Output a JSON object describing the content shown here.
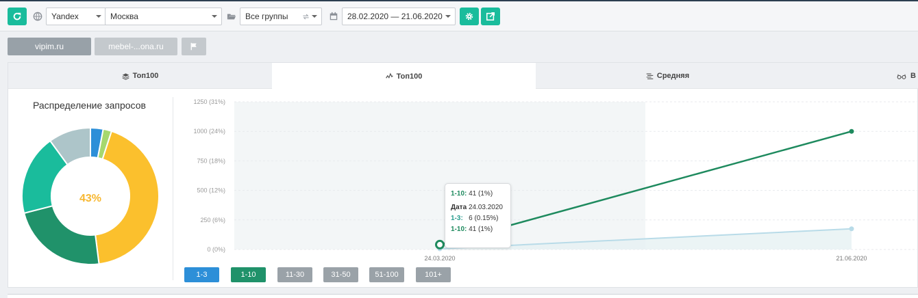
{
  "toolbar": {
    "refresh_icon": "refresh-icon",
    "globe_icon": "globe-icon",
    "search_engine": "Yandex",
    "region": "Москва",
    "folder_icon": "folder-open-icon",
    "group": "Все группы",
    "calendar_icon": "calendar-icon",
    "date_range": "28.02.2020 — 21.06.2020",
    "settings_icon": "gear-icon",
    "export_icon": "external-link-icon"
  },
  "projects": {
    "tabs": [
      "vipim.ru",
      "mebel-...ona.ru"
    ],
    "flag_icon": "flag-icon"
  },
  "panel_tabs": [
    {
      "label": "Топ100",
      "icon": "layers-icon"
    },
    {
      "label": "Топ100",
      "icon": "line-chart-icon"
    },
    {
      "label": "Средняя",
      "icon": "list-icon"
    },
    {
      "label": "В",
      "icon": "glasses-icon"
    }
  ],
  "distribution": {
    "title": "Распределение запросов",
    "center_label": "43%",
    "segments": [
      {
        "name": "1-3",
        "share": 0.03,
        "color": "#2d8fd8"
      },
      {
        "name": "1-10",
        "share": 0.02,
        "color": "#a6d86e"
      },
      {
        "name": "101+",
        "share": 0.43,
        "color": "#fbc02d"
      },
      {
        "name": "11-30",
        "share": 0.23,
        "color": "#20926a"
      },
      {
        "name": "31-50",
        "share": 0.19,
        "color": "#1abc9c"
      },
      {
        "name": "51-100",
        "share": 0.1,
        "color": "#adc5c9"
      }
    ]
  },
  "chart_data": {
    "type": "line",
    "yticks": [
      "1250 (31%)",
      "1000 (24%)",
      "750 (18%)",
      "500 (12%)",
      "250 (6%)",
      "0 (0%)"
    ],
    "ylim": [
      0,
      1250
    ],
    "x_labels": [
      "24.03.2020",
      "21.06.2020"
    ],
    "series": [
      {
        "name": "1-10",
        "color": "#1e8a5e",
        "points": [
          {
            "x": "24.03.2020",
            "y": 41
          },
          {
            "x": "21.06.2020",
            "y": 1000
          }
        ]
      },
      {
        "name": "1-3",
        "color": "#b8dbe8",
        "points": [
          {
            "x": "24.03.2020",
            "y": 6
          },
          {
            "x": "21.06.2020",
            "y": 175
          }
        ]
      }
    ],
    "legend_buttons": [
      {
        "label": "1-3",
        "color": "#2d8fd8"
      },
      {
        "label": "1-10",
        "color": "#20926a"
      },
      {
        "label": "11-30",
        "color": "#9aa2a8"
      },
      {
        "label": "31-50",
        "color": "#9aa2a8"
      },
      {
        "label": "51-100",
        "color": "#9aa2a8"
      },
      {
        "label": "101+",
        "color": "#9aa2a8"
      }
    ]
  },
  "tooltip": {
    "line1_key": "1-10:",
    "line1_val": "41 (1%)",
    "date_key": "Дата",
    "date_val": "24.03.2020",
    "line2_key": "1-3:",
    "line2_val": "6 (0.15%)",
    "line3_key": "1-10:",
    "line3_val": "41 (1%)"
  }
}
